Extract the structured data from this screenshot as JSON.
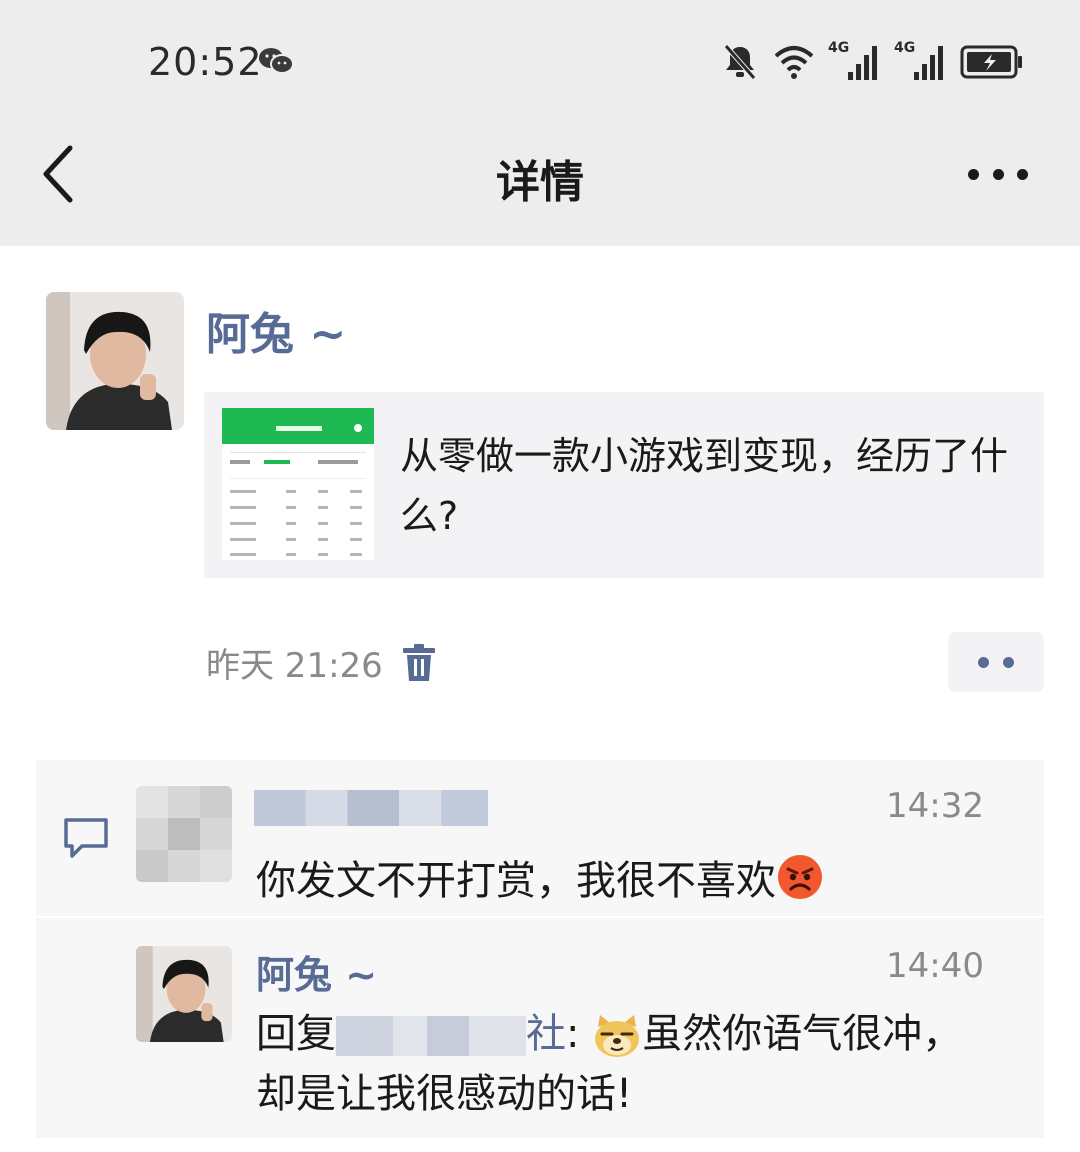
{
  "status_bar": {
    "time": "20:52",
    "network_1": "4G",
    "network_2": "4G"
  },
  "nav": {
    "title": "详情"
  },
  "post": {
    "author": "阿兔 ~",
    "link_title": "从零做一款小游戏到变现，经历了什么?",
    "timestamp": "昨天 21:26"
  },
  "comments": [
    {
      "time": "14:32",
      "text": "你发文不开打赏，我很不喜欢",
      "emoji": "angry-face"
    },
    {
      "author": "阿兔 ~",
      "time": "14:40",
      "reply_prefix": "回复",
      "reply_target_visible": "社",
      "reply_colon": ": ",
      "emoji": "doge",
      "text": "虽然你语气很冲，却是让我很感动的话!"
    }
  ],
  "colors": {
    "link_blue": "#576b95",
    "header_bg": "#ededed",
    "card_bg": "#f3f3f5",
    "comment_bg": "#f7f7f7"
  }
}
